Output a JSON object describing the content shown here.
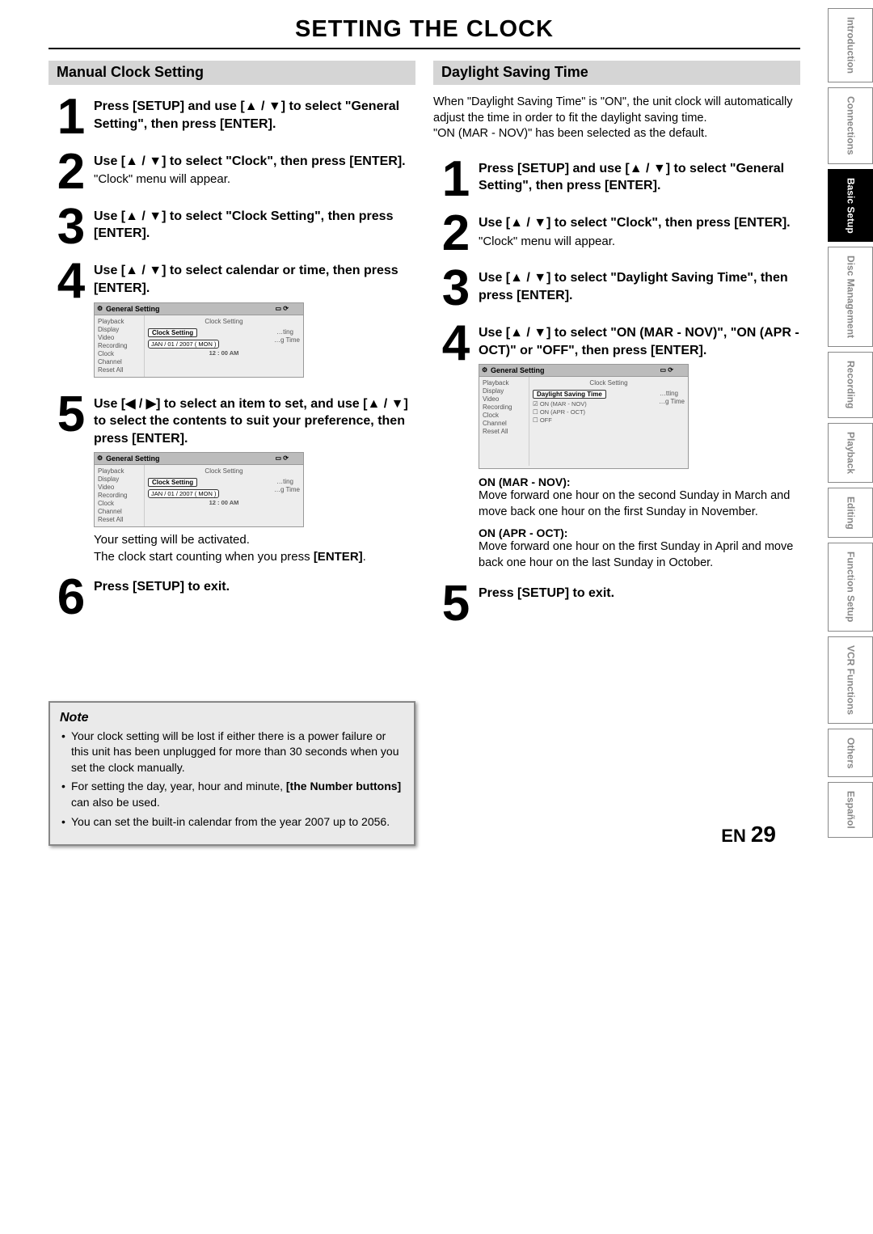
{
  "page_title": "SETTING THE CLOCK",
  "left": {
    "heading": "Manual Clock Setting",
    "steps": [
      {
        "num": "1",
        "instr": "Press [SETUP] and use [▲ / ▼] to select \"General Setting\", then press [ENTER]."
      },
      {
        "num": "2",
        "instr": "Use [▲ / ▼] to select \"Clock\", then press [ENTER].",
        "sub": "\"Clock\" menu will appear."
      },
      {
        "num": "3",
        "instr": "Use [▲ / ▼] to select \"Clock Setting\", then press [ENTER]."
      },
      {
        "num": "4",
        "instr": "Use [▲ / ▼] to select calendar or time, then press [ENTER]."
      },
      {
        "num": "5",
        "instr": "Use [◀ / ▶] to select an item to set, and use [▲ / ▼] to select the contents to suit your preference, then press [ENTER].",
        "sub2": "Your setting will be activated.\nThe clock start counting when you press [ENTER]."
      },
      {
        "num": "6",
        "instr": "Press [SETUP] to exit."
      }
    ],
    "screenshot": {
      "title": "General Setting",
      "menu": [
        "Playback",
        "Display",
        "Video",
        "Recording",
        "Clock",
        "Channel",
        "Reset All"
      ],
      "right_label": "Clock Setting",
      "right_sub1": "…ting",
      "right_sub2": "…g Time",
      "highlight": "Clock Setting",
      "date": "JAN / 01 / 2007 ( MON )",
      "time": "12 : 00 AM"
    }
  },
  "right": {
    "heading": "Daylight Saving Time",
    "intro": "When \"Daylight Saving Time\" is \"ON\", the unit clock will automatically adjust the time in order to fit the daylight saving time.\n\"ON (MAR - NOV)\" has been selected as the default.",
    "steps": [
      {
        "num": "1",
        "instr": "Press [SETUP] and use [▲ / ▼] to select \"General Setting\", then press [ENTER]."
      },
      {
        "num": "2",
        "instr": "Use [▲ / ▼] to select \"Clock\", then press [ENTER].",
        "sub": "\"Clock\" menu will appear."
      },
      {
        "num": "3",
        "instr": "Use [▲ / ▼] to select \"Daylight Saving Time\", then press [ENTER]."
      },
      {
        "num": "4",
        "instr": "Use [▲ / ▼] to select \"ON (MAR - NOV)\", \"ON (APR - OCT)\" or \"OFF\", then press [ENTER]."
      },
      {
        "num": "5",
        "instr": "Press [SETUP] to exit."
      }
    ],
    "screenshot": {
      "title": "General Setting",
      "menu": [
        "Playback",
        "Display",
        "Video",
        "Recording",
        "Clock",
        "Channel",
        "Reset All"
      ],
      "right_label": "Clock Setting",
      "right_sub1": "…tting",
      "right_sub2": "…g Time",
      "highlight": "Daylight Saving Time",
      "options": [
        "ON (MAR - NOV)",
        "ON (APR - OCT)",
        "OFF"
      ]
    },
    "explain": [
      {
        "h": "ON (MAR - NOV):",
        "t": "Move forward one hour on the second Sunday in March and move back one hour on the first Sunday in November."
      },
      {
        "h": "ON (APR - OCT):",
        "t": "Move forward one hour on the first Sunday in April and move back one hour on the last Sunday in October."
      }
    ]
  },
  "note": {
    "title": "Note",
    "items": [
      "Your clock setting will be lost if either there is a power failure or this unit has been unplugged for more than 30 seconds when you set the clock manually.",
      "For setting the day, year, hour and minute, [the Number buttons] can also be used.",
      "You can set the built-in calendar from the year 2007 up to 2056."
    ],
    "bold_phrase": "[the Number buttons]"
  },
  "footer": {
    "lang": "EN",
    "page": "29"
  },
  "tabs": [
    "Introduction",
    "Connections",
    "Basic Setup",
    "Disc Management",
    "Recording",
    "Playback",
    "Editing",
    "Function Setup",
    "VCR Functions",
    "Others",
    "Español"
  ],
  "active_tab": "Basic Setup"
}
